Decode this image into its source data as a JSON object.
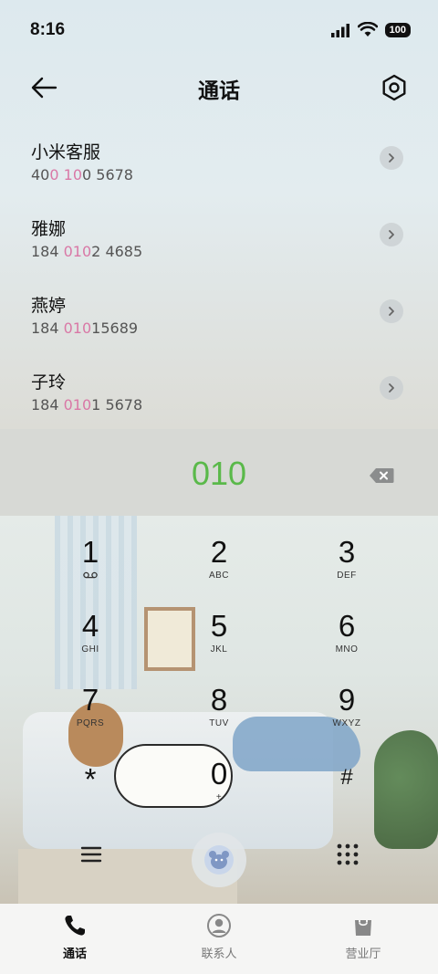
{
  "status_bar": {
    "time": "8:16",
    "battery": "100"
  },
  "header": {
    "title": "通话"
  },
  "contacts": [
    {
      "name": "小米客服",
      "number_parts": [
        "40",
        "0",
        " ",
        "10",
        "0 5678"
      ]
    },
    {
      "name": "雅娜",
      "number_parts": [
        "184 ",
        "010",
        "2 4685"
      ]
    },
    {
      "name": "燕婷",
      "number_parts": [
        "184 ",
        "010",
        "15689"
      ]
    },
    {
      "name": "子玲",
      "number_parts": [
        "184 ",
        "010",
        "1 5678"
      ]
    }
  ],
  "dialer": {
    "digits": "010",
    "keys": [
      {
        "digit": "1",
        "letters": ""
      },
      {
        "digit": "2",
        "letters": "ABC"
      },
      {
        "digit": "3",
        "letters": "DEF"
      },
      {
        "digit": "4",
        "letters": "GHI"
      },
      {
        "digit": "5",
        "letters": "JKL"
      },
      {
        "digit": "6",
        "letters": "MNO"
      },
      {
        "digit": "7",
        "letters": "PQRS"
      },
      {
        "digit": "8",
        "letters": "TUV"
      },
      {
        "digit": "9",
        "letters": "WXYZ"
      },
      {
        "digit": "*",
        "letters": ""
      },
      {
        "digit": "0",
        "letters": "+"
      },
      {
        "digit": "#",
        "letters": ""
      }
    ]
  },
  "bottom_nav": {
    "items": [
      {
        "label": "通话",
        "icon": "phone-icon",
        "active": true
      },
      {
        "label": "联系人",
        "icon": "person-icon",
        "active": false
      },
      {
        "label": "营业厅",
        "icon": "shop-bag-icon",
        "active": false
      }
    ]
  },
  "colors": {
    "digits": "#5ab94a",
    "number_highlight": "#d978a6"
  }
}
